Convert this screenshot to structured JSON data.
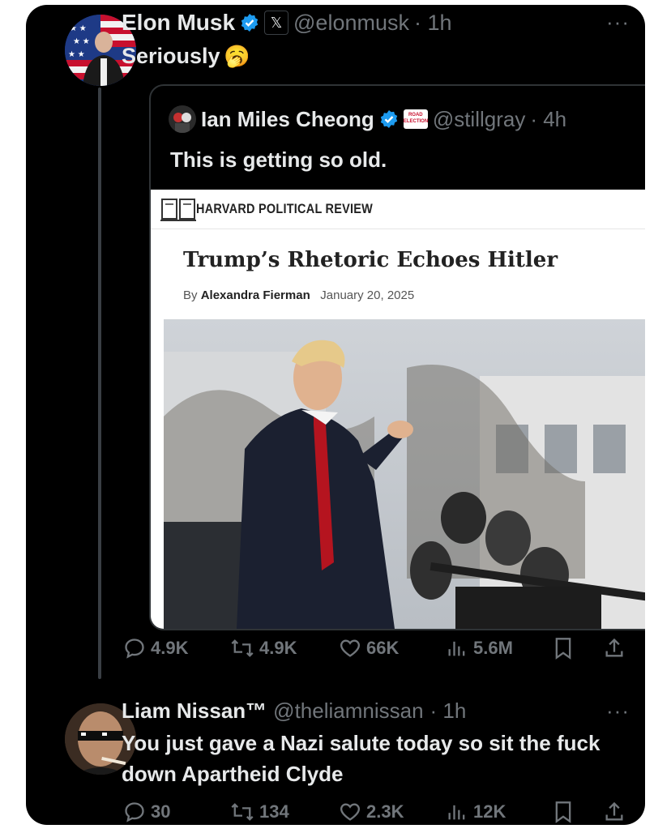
{
  "main_tweet": {
    "author_name": "Elon Musk",
    "handle": "@elonmusk",
    "time": "· 1h",
    "text": "Seriously",
    "emoji": "🥱",
    "more": "···"
  },
  "quoted_tweet": {
    "author_name": "Ian Miles Cheong",
    "handle": "@stillgray",
    "time": "· 4h",
    "text": "This is getting so old.",
    "affiliate_badge": "ROAD ELECTION",
    "article": {
      "publication": "HARVARD POLITICAL REVIEW",
      "title": "Trump’s Rhetoric Echoes Hitler",
      "by": "By",
      "author": "Alexandra Fierman",
      "date": "January 20, 2025"
    }
  },
  "main_actions": {
    "replies": "4.9K",
    "reposts": "4.9K",
    "likes": "66K",
    "views": "5.6M"
  },
  "reply_tweet": {
    "author_name": "Liam Nissan™",
    "handle": "@theliamnissan",
    "time": "· 1h",
    "text": "You just gave a Nazi salute today so sit the fuck down Apartheid Clyde",
    "more": "···"
  },
  "reply_actions": {
    "replies": "30",
    "reposts": "134",
    "likes": "2.3K",
    "views": "12K"
  },
  "colors": {
    "background": "#000000",
    "text": "#e7e9ea",
    "muted": "#71767b",
    "verified": "#1d9bf0"
  }
}
